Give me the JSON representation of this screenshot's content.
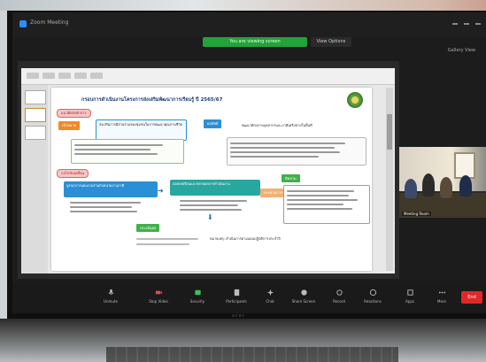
{
  "window": {
    "app_title": "Zoom Meeting"
  },
  "share_banner": "You are viewing screen",
  "view_options": "View Options",
  "top_right": "Gallery View",
  "slide": {
    "title": "กรอบการดำเนินงานโครงการส่งเสริมพัฒนาการเรียนรู้ ปี 2565/67",
    "section1": "แนวคิด/หลักการ",
    "section2": "กลไกขับเคลื่อน",
    "tag1": "เป้าหมาย",
    "tag2": "ผลลัพธ์",
    "tag3": "กระบวนการ",
    "tag4": "ติดตาม",
    "tag5": "ประเมินผล",
    "box1": "ส่งเสริมการมีส่วนร่วมของชุมชนในการพัฒนาคุณภาพชีวิต",
    "box2": "พัฒนาศักยภาพบุคลากรและภาคีเครือข่ายในพื้นที่",
    "box3": "บูรณาการแผนงานร่วมกับหน่วยงานภาคี",
    "box4": "ถอดบทเรียนและขยายผลการดำเนินงาน",
    "footnote": "หมายเหตุ: ดำเนินการตามแผนปฏิบัติการประจำปี"
  },
  "video": {
    "name": "Meeting Room"
  },
  "toolbar": {
    "buttons": [
      {
        "label": "Unmute",
        "icon": "microphone-icon",
        "color": "#bbbbbb"
      },
      {
        "label": "Stop Video",
        "icon": "video-camera-icon",
        "color": "#e24b4b"
      },
      {
        "label": "Security",
        "icon": "shield-icon",
        "color": "#3ac15a"
      },
      {
        "label": "Participants",
        "icon": "participants-icon",
        "color": "#bbbbbb"
      },
      {
        "label": "Chat",
        "icon": "chat-icon",
        "color": "#bbbbbb"
      },
      {
        "label": "Share Screen",
        "icon": "share-screen-icon",
        "color": "#bbbbbb"
      },
      {
        "label": "Record",
        "icon": "record-icon",
        "color": "#bbbbbb"
      },
      {
        "label": "Reactions",
        "icon": "reactions-icon",
        "color": "#bbbbbb"
      },
      {
        "label": "Apps",
        "icon": "apps-icon",
        "color": "#bbbbbb"
      },
      {
        "label": "More",
        "icon": "more-icon",
        "color": "#bbbbbb"
      }
    ],
    "end_label": "End"
  },
  "monitor_brand": "acer"
}
